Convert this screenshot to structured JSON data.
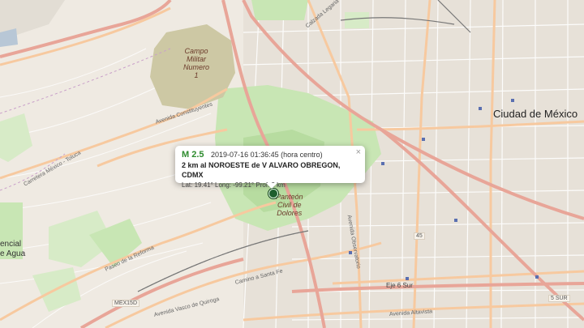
{
  "map": {
    "labels": {
      "city": "Ciudad de México",
      "park_military": [
        "Campo",
        "Militar",
        "Numero",
        "1"
      ],
      "park_cemetery": [
        "Panteón",
        "Civil de",
        "Dolores"
      ],
      "left_edge": [
        "encial",
        "e Agua"
      ],
      "eje_6_sur": "Eje 6 Sur",
      "shield_15d": "MEX15D",
      "shield_45": "45",
      "shield_5sur": "5 SUR",
      "road_calzada_legaria": "Calzada Legaria",
      "road_toluca": "Carretera México - Toluca",
      "road_constituyentes": "Avenida Constituyentes",
      "road_reforma": "Paseo de la Reforma",
      "road_observatorio": "Avenida Observatorio",
      "road_santa_fe": "Camino a Santa Fe",
      "road_vasco": "Avenida Vasco de Quiroga",
      "road_altavista": "Avenida Altavista"
    }
  },
  "popup": {
    "magnitude": "M 2.5",
    "datetime": "2019-07-16  01:36:45 (hora centro)",
    "location": "2 km al NOROESTE de V ALVARO OBREGON, CDMX",
    "coords": "Lat: 19.41°  Long: -99.21°  Prof: 3 km",
    "close_glyph": "×"
  },
  "colors": {
    "land": "#efeae2",
    "park_green": "#c8e6b4",
    "military": "#cdc8a4",
    "major_road": "#e8a598",
    "arterial": "#f7c99f",
    "minor_road": "#ffffff",
    "rail": "#777777",
    "marker": "#1f5f2e",
    "magnitude": "#2e8b2e"
  }
}
